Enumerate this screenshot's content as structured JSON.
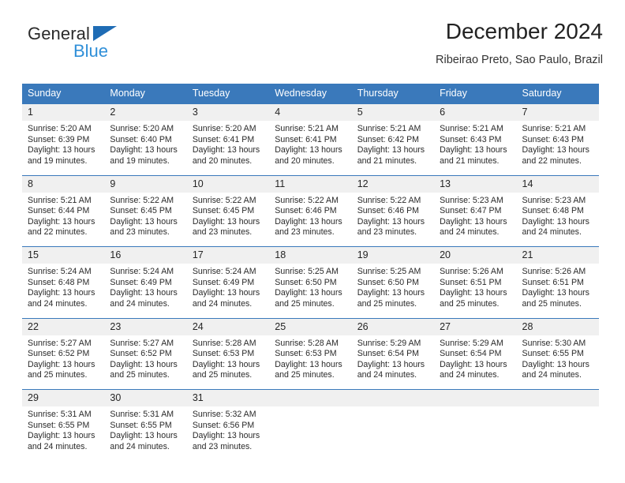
{
  "brand": {
    "name_top": "General",
    "name_bottom": "Blue",
    "accent_color": "#1f6cb5",
    "blue_text_color": "#2f8fd8"
  },
  "header": {
    "title": "December 2024",
    "subtitle": "Ribeirao Preto, Sao Paulo, Brazil"
  },
  "theme": {
    "header_bg": "#3a79bb",
    "daynum_bg": "#f0f0f0",
    "page_bg": "#ffffff",
    "text_color": "#2a2a2a"
  },
  "weekdays": [
    "Sunday",
    "Monday",
    "Tuesday",
    "Wednesday",
    "Thursday",
    "Friday",
    "Saturday"
  ],
  "weeks": [
    [
      {
        "day": "1",
        "sunrise": "Sunrise: 5:20 AM",
        "sunset": "Sunset: 6:39 PM",
        "daylight1": "Daylight: 13 hours",
        "daylight2": "and 19 minutes."
      },
      {
        "day": "2",
        "sunrise": "Sunrise: 5:20 AM",
        "sunset": "Sunset: 6:40 PM",
        "daylight1": "Daylight: 13 hours",
        "daylight2": "and 19 minutes."
      },
      {
        "day": "3",
        "sunrise": "Sunrise: 5:20 AM",
        "sunset": "Sunset: 6:41 PM",
        "daylight1": "Daylight: 13 hours",
        "daylight2": "and 20 minutes."
      },
      {
        "day": "4",
        "sunrise": "Sunrise: 5:21 AM",
        "sunset": "Sunset: 6:41 PM",
        "daylight1": "Daylight: 13 hours",
        "daylight2": "and 20 minutes."
      },
      {
        "day": "5",
        "sunrise": "Sunrise: 5:21 AM",
        "sunset": "Sunset: 6:42 PM",
        "daylight1": "Daylight: 13 hours",
        "daylight2": "and 21 minutes."
      },
      {
        "day": "6",
        "sunrise": "Sunrise: 5:21 AM",
        "sunset": "Sunset: 6:43 PM",
        "daylight1": "Daylight: 13 hours",
        "daylight2": "and 21 minutes."
      },
      {
        "day": "7",
        "sunrise": "Sunrise: 5:21 AM",
        "sunset": "Sunset: 6:43 PM",
        "daylight1": "Daylight: 13 hours",
        "daylight2": "and 22 minutes."
      }
    ],
    [
      {
        "day": "8",
        "sunrise": "Sunrise: 5:21 AM",
        "sunset": "Sunset: 6:44 PM",
        "daylight1": "Daylight: 13 hours",
        "daylight2": "and 22 minutes."
      },
      {
        "day": "9",
        "sunrise": "Sunrise: 5:22 AM",
        "sunset": "Sunset: 6:45 PM",
        "daylight1": "Daylight: 13 hours",
        "daylight2": "and 23 minutes."
      },
      {
        "day": "10",
        "sunrise": "Sunrise: 5:22 AM",
        "sunset": "Sunset: 6:45 PM",
        "daylight1": "Daylight: 13 hours",
        "daylight2": "and 23 minutes."
      },
      {
        "day": "11",
        "sunrise": "Sunrise: 5:22 AM",
        "sunset": "Sunset: 6:46 PM",
        "daylight1": "Daylight: 13 hours",
        "daylight2": "and 23 minutes."
      },
      {
        "day": "12",
        "sunrise": "Sunrise: 5:22 AM",
        "sunset": "Sunset: 6:46 PM",
        "daylight1": "Daylight: 13 hours",
        "daylight2": "and 23 minutes."
      },
      {
        "day": "13",
        "sunrise": "Sunrise: 5:23 AM",
        "sunset": "Sunset: 6:47 PM",
        "daylight1": "Daylight: 13 hours",
        "daylight2": "and 24 minutes."
      },
      {
        "day": "14",
        "sunrise": "Sunrise: 5:23 AM",
        "sunset": "Sunset: 6:48 PM",
        "daylight1": "Daylight: 13 hours",
        "daylight2": "and 24 minutes."
      }
    ],
    [
      {
        "day": "15",
        "sunrise": "Sunrise: 5:24 AM",
        "sunset": "Sunset: 6:48 PM",
        "daylight1": "Daylight: 13 hours",
        "daylight2": "and 24 minutes."
      },
      {
        "day": "16",
        "sunrise": "Sunrise: 5:24 AM",
        "sunset": "Sunset: 6:49 PM",
        "daylight1": "Daylight: 13 hours",
        "daylight2": "and 24 minutes."
      },
      {
        "day": "17",
        "sunrise": "Sunrise: 5:24 AM",
        "sunset": "Sunset: 6:49 PM",
        "daylight1": "Daylight: 13 hours",
        "daylight2": "and 24 minutes."
      },
      {
        "day": "18",
        "sunrise": "Sunrise: 5:25 AM",
        "sunset": "Sunset: 6:50 PM",
        "daylight1": "Daylight: 13 hours",
        "daylight2": "and 25 minutes."
      },
      {
        "day": "19",
        "sunrise": "Sunrise: 5:25 AM",
        "sunset": "Sunset: 6:50 PM",
        "daylight1": "Daylight: 13 hours",
        "daylight2": "and 25 minutes."
      },
      {
        "day": "20",
        "sunrise": "Sunrise: 5:26 AM",
        "sunset": "Sunset: 6:51 PM",
        "daylight1": "Daylight: 13 hours",
        "daylight2": "and 25 minutes."
      },
      {
        "day": "21",
        "sunrise": "Sunrise: 5:26 AM",
        "sunset": "Sunset: 6:51 PM",
        "daylight1": "Daylight: 13 hours",
        "daylight2": "and 25 minutes."
      }
    ],
    [
      {
        "day": "22",
        "sunrise": "Sunrise: 5:27 AM",
        "sunset": "Sunset: 6:52 PM",
        "daylight1": "Daylight: 13 hours",
        "daylight2": "and 25 minutes."
      },
      {
        "day": "23",
        "sunrise": "Sunrise: 5:27 AM",
        "sunset": "Sunset: 6:52 PM",
        "daylight1": "Daylight: 13 hours",
        "daylight2": "and 25 minutes."
      },
      {
        "day": "24",
        "sunrise": "Sunrise: 5:28 AM",
        "sunset": "Sunset: 6:53 PM",
        "daylight1": "Daylight: 13 hours",
        "daylight2": "and 25 minutes."
      },
      {
        "day": "25",
        "sunrise": "Sunrise: 5:28 AM",
        "sunset": "Sunset: 6:53 PM",
        "daylight1": "Daylight: 13 hours",
        "daylight2": "and 25 minutes."
      },
      {
        "day": "26",
        "sunrise": "Sunrise: 5:29 AM",
        "sunset": "Sunset: 6:54 PM",
        "daylight1": "Daylight: 13 hours",
        "daylight2": "and 24 minutes."
      },
      {
        "day": "27",
        "sunrise": "Sunrise: 5:29 AM",
        "sunset": "Sunset: 6:54 PM",
        "daylight1": "Daylight: 13 hours",
        "daylight2": "and 24 minutes."
      },
      {
        "day": "28",
        "sunrise": "Sunrise: 5:30 AM",
        "sunset": "Sunset: 6:55 PM",
        "daylight1": "Daylight: 13 hours",
        "daylight2": "and 24 minutes."
      }
    ],
    [
      {
        "day": "29",
        "sunrise": "Sunrise: 5:31 AM",
        "sunset": "Sunset: 6:55 PM",
        "daylight1": "Daylight: 13 hours",
        "daylight2": "and 24 minutes."
      },
      {
        "day": "30",
        "sunrise": "Sunrise: 5:31 AM",
        "sunset": "Sunset: 6:55 PM",
        "daylight1": "Daylight: 13 hours",
        "daylight2": "and 24 minutes."
      },
      {
        "day": "31",
        "sunrise": "Sunrise: 5:32 AM",
        "sunset": "Sunset: 6:56 PM",
        "daylight1": "Daylight: 13 hours",
        "daylight2": "and 23 minutes."
      },
      {
        "day": "",
        "sunrise": "",
        "sunset": "",
        "daylight1": "",
        "daylight2": ""
      },
      {
        "day": "",
        "sunrise": "",
        "sunset": "",
        "daylight1": "",
        "daylight2": ""
      },
      {
        "day": "",
        "sunrise": "",
        "sunset": "",
        "daylight1": "",
        "daylight2": ""
      },
      {
        "day": "",
        "sunrise": "",
        "sunset": "",
        "daylight1": "",
        "daylight2": ""
      }
    ]
  ]
}
